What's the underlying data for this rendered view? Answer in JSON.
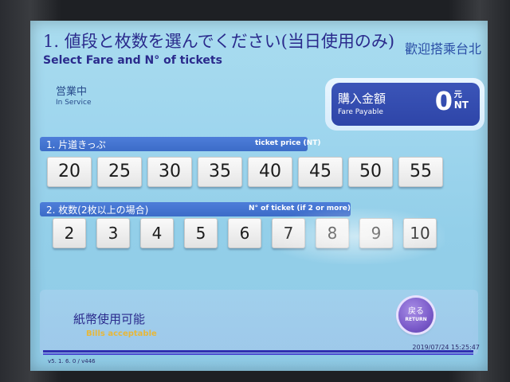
{
  "header": {
    "title_jp": "1. 値段と枚数を選んでください(当日使用のみ)",
    "title_en": "Select Fare and N° of tickets",
    "welcome": "歡迎搭乘台北"
  },
  "status": {
    "label_jp": "営業中",
    "label_en": "In Service"
  },
  "fare": {
    "label_jp": "購入金額",
    "label_en": "Fare Payable",
    "amount": "0",
    "unit_jp": "元",
    "unit_en": "NT"
  },
  "price_section": {
    "label": "1.  片道きっぷ",
    "label_en": "ticket price (NT)",
    "options": [
      "20",
      "25",
      "30",
      "35",
      "40",
      "45",
      "50",
      "55"
    ]
  },
  "count_section": {
    "label": "2.  枚数(2枚以上の場合)",
    "label_en": "N° of ticket (if 2 or more)",
    "options": [
      "2",
      "3",
      "4",
      "5",
      "6",
      "7",
      "8",
      "9",
      "10"
    ]
  },
  "bills": {
    "label_jp": "紙幣使用可能",
    "label_en": "Bills acceptable"
  },
  "return_button": {
    "label_jp": "戻る",
    "label_en": "RETURN"
  },
  "footer": {
    "version": "v5. 1. 6. 0 / v446",
    "timestamp": "2019/07/24 15:25:47"
  },
  "colors": {
    "title_text": "#2a2a8c",
    "fare_panel": "#2e45a8",
    "section_bar": "#3c6cc8",
    "return_button": "#7a5ac9",
    "bills_en_text": "#e7b73a"
  }
}
